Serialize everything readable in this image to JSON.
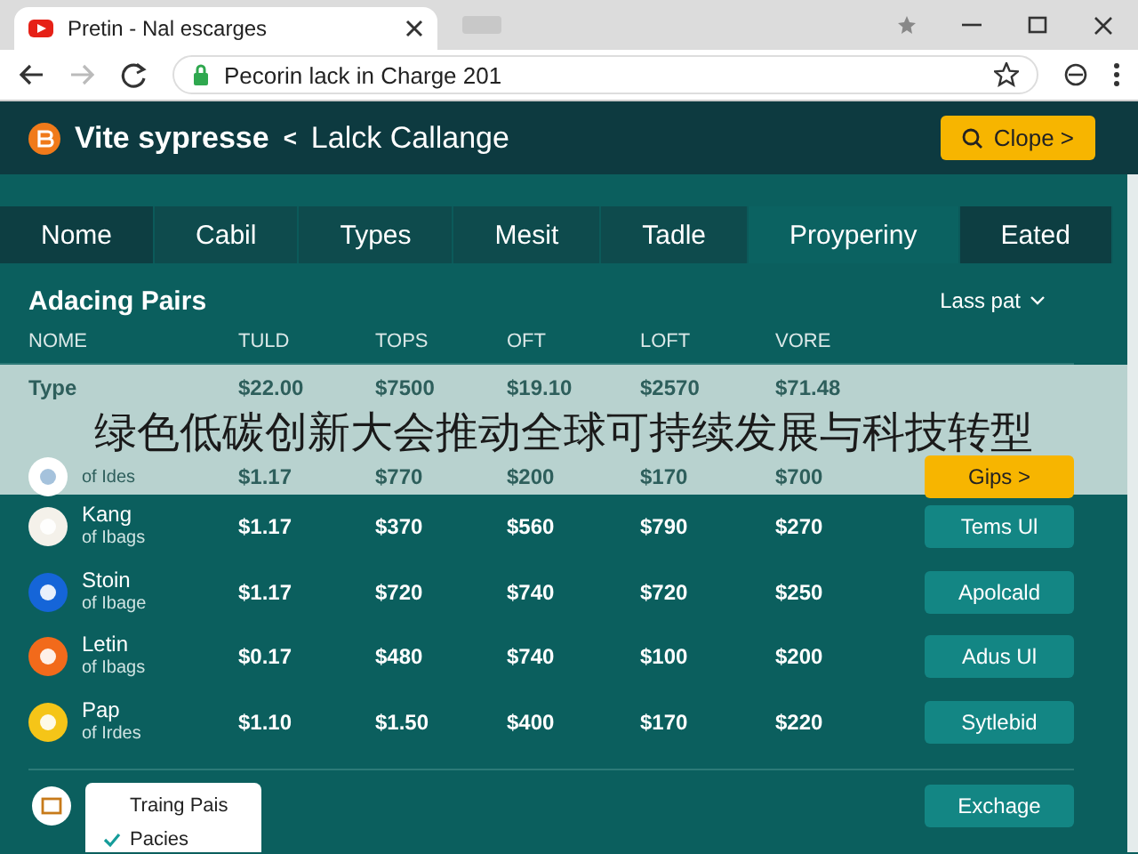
{
  "browser": {
    "tab_title": "Pretin - Nal escarges",
    "url": "Pecorin lack in Charge 201"
  },
  "header": {
    "title": "Vite sypresse",
    "separator": "<",
    "subtitle": "Lalck Callange",
    "button": "Clope >"
  },
  "nav_tabs": [
    {
      "label": "Nome",
      "selected": false
    },
    {
      "label": "Cabil",
      "selected": false
    },
    {
      "label": "Types",
      "selected": false
    },
    {
      "label": "Mesit",
      "selected": false
    },
    {
      "label": "Tadle",
      "selected": false
    },
    {
      "label": "Proyperiny",
      "selected": true
    },
    {
      "label": "Eated",
      "selected": false
    }
  ],
  "section": {
    "title": "Adacing Pairs",
    "filter": "Lass pat"
  },
  "table": {
    "columns": [
      "NOME",
      "TULD",
      "TOPS",
      "OFT",
      "LOFT",
      "VORE"
    ],
    "rows": [
      {
        "kind": "summary",
        "name": "Type",
        "values": [
          "$22.00",
          "$7500",
          "$19.10",
          "$2570",
          "$71.48"
        ]
      },
      {
        "kind": "asset",
        "color": "#ffffff",
        "sub": "of Ides",
        "values": [
          "$1.17",
          "$770",
          "$200",
          "$170",
          "$700"
        ],
        "action": {
          "label": "Gips >",
          "kind": "highlight"
        }
      },
      {
        "kind": "asset",
        "color": "#f4f1ea",
        "name": "Kang",
        "sub": "of Ibags",
        "values": [
          "$1.17",
          "$370",
          "$560",
          "$790",
          "$270"
        ],
        "action": {
          "label": "Tems Ul",
          "kind": "plain"
        }
      },
      {
        "kind": "asset",
        "color": "#1565d8",
        "name": "Stoin",
        "sub": "of Ibage",
        "values": [
          "$1.17",
          "$720",
          "$740",
          "$720",
          "$250"
        ],
        "action": {
          "label": "Apolcald",
          "kind": "plain"
        }
      },
      {
        "kind": "asset",
        "color": "#f26a1b",
        "name": "Letin",
        "sub": "of Ibags",
        "values": [
          "$0.17",
          "$480",
          "$740",
          "$100",
          "$200"
        ],
        "action": {
          "label": "Adus Ul",
          "kind": "plain"
        }
      },
      {
        "kind": "asset",
        "color": "#f5c518",
        "name": "Pap",
        "sub": "of Irdes",
        "values": [
          "$1.10",
          "$1.50",
          "$400",
          "$170",
          "$220"
        ],
        "action": {
          "label": "Sytlebid",
          "kind": "plain"
        }
      }
    ],
    "footer_action": "Exchage"
  },
  "dropdown": [
    {
      "label": "Traing Pais",
      "checked": false
    },
    {
      "label": "Pacies",
      "checked": true
    }
  ],
  "overlay_banner": "绿色低碳创新大会推动全球可持续发展与科技转型"
}
